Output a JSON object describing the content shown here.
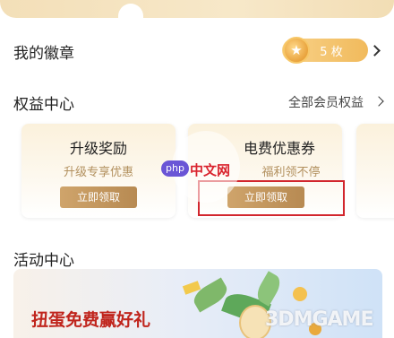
{
  "medal_section": {
    "title": "我的徽章",
    "count": "5 枚"
  },
  "benefit_section": {
    "title": "权益中心",
    "all_link": "全部会员权益",
    "cards": [
      {
        "title": "升级奖励",
        "subtitle": "升级专享优惠",
        "button": "立即领取"
      },
      {
        "title": "电费优惠券",
        "subtitle": "福利领不停",
        "button": "立即领取"
      }
    ]
  },
  "activity_section": {
    "title": "活动中心",
    "banner_title": "扭蛋免费赢好礼"
  },
  "watermarks": {
    "php_badge": "php",
    "php_text": "中文网",
    "game_site": "3DMGAME"
  },
  "colors": {
    "accent_gold": "#b78a52",
    "highlight_red": "#d2262d",
    "banner_red": "#c0251d"
  }
}
